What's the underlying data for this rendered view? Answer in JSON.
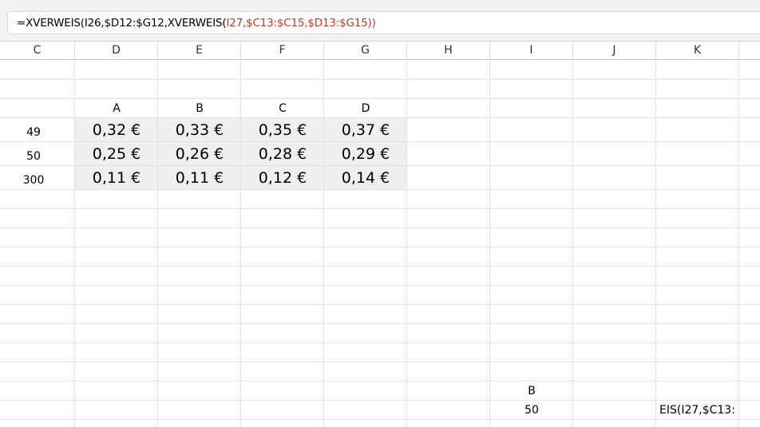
{
  "formula_bar": {
    "prefix": "=XVERWEIS(I26,$D12:$G12,XVERWEIS(",
    "ref": "I27,$C13:$C15,$D13:$G15",
    "suffix": "))"
  },
  "columns": [
    "C",
    "D",
    "E",
    "F",
    "G",
    "H",
    "I",
    "J",
    "K"
  ],
  "tier_labels": [
    "A",
    "B",
    "C",
    "D"
  ],
  "rows": [
    {
      "qty": "49",
      "prices": [
        "0,32 €",
        "0,33 €",
        "0,35 €",
        "0,37 €"
      ]
    },
    {
      "qty": "50",
      "prices": [
        "0,25 €",
        "0,26 €",
        "0,28 €",
        "0,29 €"
      ]
    },
    {
      "qty": "300",
      "prices": [
        "0,11 €",
        "0,11 €",
        "0,12 €",
        "0,14 €"
      ]
    }
  ],
  "lookup": {
    "tier": "B",
    "qty": "50"
  },
  "overflow_text": "EIS(I27,$C13:"
}
